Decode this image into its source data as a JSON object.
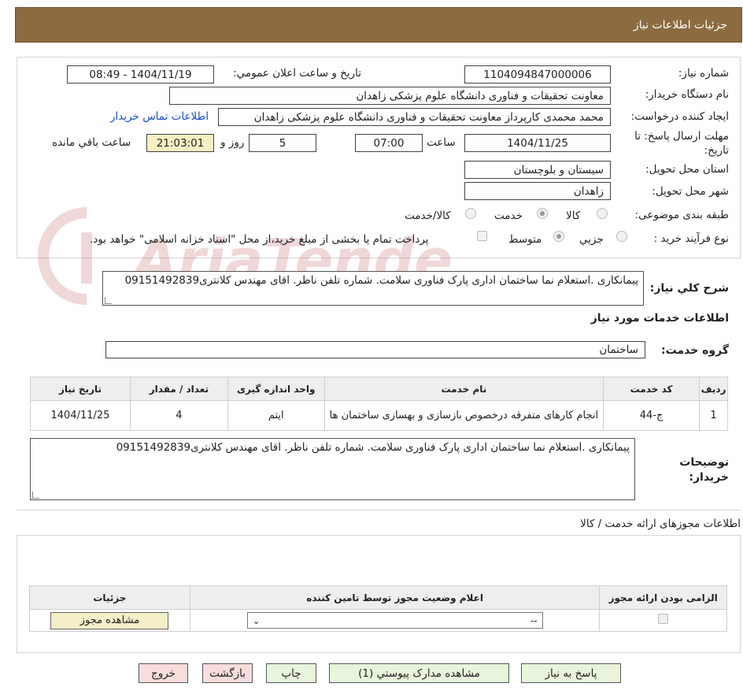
{
  "header": {
    "title": "جزئیات اطلاعات نیاز"
  },
  "form": {
    "need_number_label": "شماره نیاز:",
    "need_number": "1104094847000006",
    "announce_label": "تاریخ و ساعت اعلان عمومي:",
    "announce_value": "1404/11/19 - 08:49",
    "buyer_org_label": "نام دستگاه خريدار:",
    "buyer_org": "معاونت تحقیقات و فناوری دانشگاه علوم پزشکی زاهدان",
    "requester_label": "ايجاد كننده درخواست:",
    "requester": "محمد محمدی کارپرداز معاونت تحقیقات و فناوری دانشگاه علوم پزشکی زاهدان",
    "contact_link": "اطلاعات تماس خريدار",
    "deadline_label": "مهلت ارسال پاسخ: تا تاريخ:",
    "deadline_date": "1404/11/25",
    "hour_label": "ساعت",
    "deadline_time": "07:00",
    "days": "5",
    "days_label": "روز و",
    "remaining": "21:03:01",
    "remaining_label": "ساعت باقي مانده",
    "province_label": "استان محل تحويل:",
    "province": "سیستان و بلوچستان",
    "city_label": "شهر محل تحويل:",
    "city": "زاهدان",
    "category_label": "طبقه بندی موضوعی:",
    "category_options": [
      "كالا",
      "خدمت",
      "كالا/خدمت"
    ],
    "category_selected": "خدمت",
    "process_label": "نوع فرآيند خريد :",
    "process_options": [
      "جزيي",
      "متوسط"
    ],
    "process_selected": "متوسط",
    "payment_note": "پرداخت تمام يا بخشی از مبلغ خريد،از محل \"اسناد خزانه اسلامی\" خواهد بود."
  },
  "summary": {
    "label": "شرح كلي نياز:",
    "text": "پیمانکاری .استعلام نما ساختمان اداری پارک فناوری سلامت. شماره تلفن ناظر. اقای مهندس کلانتری09151492839"
  },
  "services": {
    "section_title": "اطلاعات خدمات مورد نياز",
    "group_label": "گروه خدمت:",
    "group_value": "ساختمان",
    "columns": [
      "رديف",
      "كد خدمت",
      "نام خدمت",
      "واحد اندازه گيری",
      "تعداد / مقدار",
      "تاريخ نياز"
    ],
    "rows": [
      {
        "row": "1",
        "code": "ج-44",
        "name": "انجام کارهای متفرقه درخصوص بازسازی و بهسازی ساختمان ها",
        "unit": "ایتم",
        "qty": "4",
        "date": "1404/11/25"
      }
    ]
  },
  "buyer_notes": {
    "label": "توضيحات خريدار:",
    "text": "پیمانکاری .استعلام نما ساختمان اداری پارک فناوری سلامت. شماره تلفن ناظر. اقای مهندس کلانتری09151492839"
  },
  "permits": {
    "section_title": "اطلاعات مجوزهای ارائه خدمت / كالا",
    "columns": [
      "الزامی بودن ارائه مجوز",
      "اعلام وضعيت مجوز توسط تامين كننده",
      "جزئيات"
    ],
    "select_value": "--",
    "view_button": "مشاهده مجوز"
  },
  "buttons": {
    "reply": "پاسخ به نياز",
    "view_docs": "مشاهده مدارک پيوستي (1)",
    "print": "چاپ",
    "back": "بازگشت",
    "exit": "خروج"
  },
  "watermark": {
    "text": "AriaTender.neT"
  }
}
